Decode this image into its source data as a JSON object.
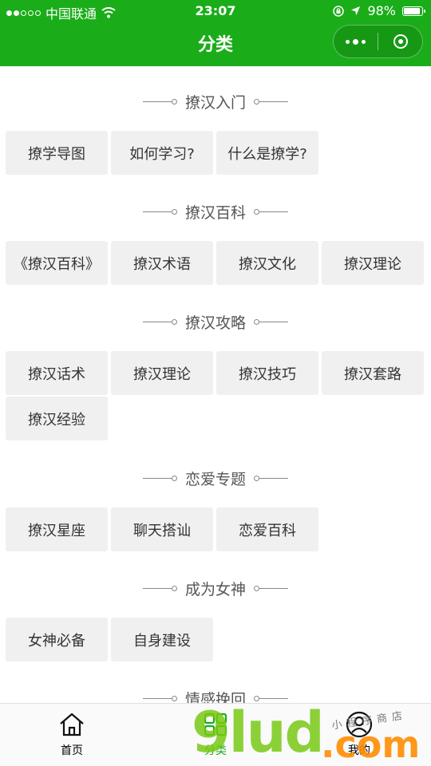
{
  "status_bar": {
    "carrier": "中国联通",
    "time": "23:07",
    "battery": "98%"
  },
  "header": {
    "title": "分类"
  },
  "sections": [
    {
      "title": "撩汉入门",
      "items": [
        "撩学导图",
        "如何学习?",
        "什么是撩学?"
      ]
    },
    {
      "title": "撩汉百科",
      "items": [
        "《撩汉百科》",
        "撩汉术语",
        "撩汉文化",
        "撩汉理论"
      ]
    },
    {
      "title": "撩汉攻略",
      "items": [
        "撩汉话术",
        "撩汉理论",
        "撩汉技巧",
        "撩汉套路",
        "撩汉经验"
      ]
    },
    {
      "title": "恋爱专题",
      "items": [
        "撩汉星座",
        "聊天搭讪",
        "恋爱百科"
      ]
    },
    {
      "title": "成为女神",
      "items": [
        "女神必备",
        "自身建设"
      ]
    },
    {
      "title": "情感挽回",
      "items": []
    }
  ],
  "tabbar": {
    "home": "首页",
    "category": "分类",
    "mine": "我的"
  },
  "watermark": {
    "main": "9lud",
    "suffix": ".com",
    "script": "小程序商店"
  },
  "colors": {
    "brand": "#1aad19",
    "tag_bg": "#f0f0f0"
  },
  "icons": [
    "wifi-icon",
    "lock-rotation-icon",
    "location-arrow-icon",
    "battery-icon",
    "more-icon",
    "close-target-icon",
    "home-icon",
    "category-icon",
    "user-icon"
  ]
}
